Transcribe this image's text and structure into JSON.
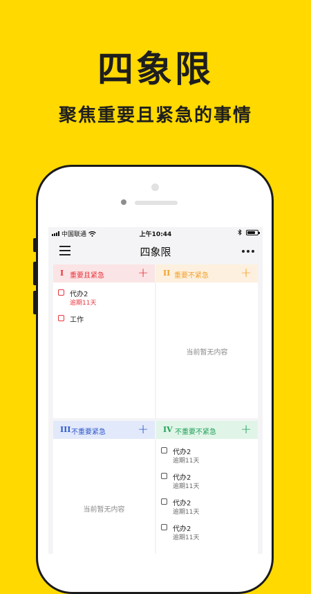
{
  "promo": {
    "title": "四象限",
    "subtitle": "聚焦重要且紧急的事情"
  },
  "status_bar": {
    "carrier": "中国联通",
    "time": "上午10:44",
    "battery_level_percent": 80
  },
  "nav": {
    "title": "四象限",
    "menu_icon": "menu-icon",
    "more_icon": "more-icon"
  },
  "quadrants": [
    {
      "numeral": "I",
      "label": "重要且紧急",
      "add": "+",
      "color": "#E8333C",
      "header_bg": "#FBE4E5",
      "empty_text": "",
      "tasks": [
        {
          "name": "代办2",
          "sub": "逾期11天"
        },
        {
          "name": "工作",
          "sub": ""
        }
      ]
    },
    {
      "numeral": "II",
      "label": "重要不紧急",
      "add": "+",
      "color": "#F2A12E",
      "header_bg": "#FDF0DE",
      "empty_text": "当前暂无内容",
      "tasks": []
    },
    {
      "numeral": "III",
      "label": "不重要紧急",
      "add": "+",
      "color": "#2F59C9",
      "header_bg": "#E2E9FB",
      "empty_text": "当前暂无内容",
      "tasks": []
    },
    {
      "numeral": "IV",
      "label": "不重要不紧急",
      "add": "+",
      "color": "#23A05A",
      "header_bg": "#E0F5E8",
      "empty_text": "",
      "tasks": [
        {
          "name": "代办2",
          "sub": "逾期11天"
        },
        {
          "name": "代办2",
          "sub": "逾期11天"
        },
        {
          "name": "代办2",
          "sub": "逾期11天"
        },
        {
          "name": "代办2",
          "sub": "逾期11天"
        }
      ]
    }
  ]
}
